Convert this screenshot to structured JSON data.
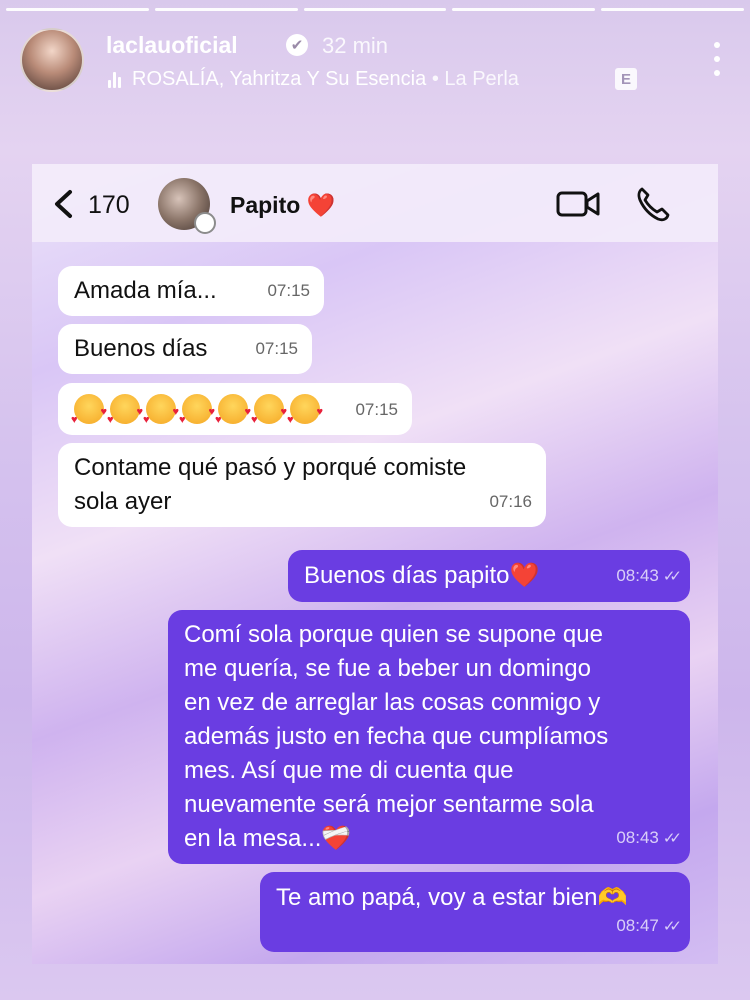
{
  "story": {
    "progress_segments": 5,
    "progress_completed": 5,
    "username": "laclauoficial",
    "verified_glyph": "✔",
    "time_ago": "32 min",
    "music_artists": "ROSALÍA, Yahritza Y Su Esencia",
    "music_separator": "•",
    "music_song": "La Perla",
    "explicit_badge": "E"
  },
  "chat": {
    "back_count": "170",
    "contact_name": "Papito",
    "contact_emoji": "❤️",
    "icons": {
      "back": "chevron-left-icon",
      "video": "video-camera-icon",
      "call": "phone-icon"
    },
    "messages": [
      {
        "direction": "in",
        "text": "Amada mía...",
        "time": "07:15"
      },
      {
        "direction": "in",
        "text": "Buenos días",
        "time": "07:15"
      },
      {
        "direction": "in",
        "text": "🥰🥰🥰🥰🥰🥰🥰",
        "emoji_count": 7,
        "emoji_name": "smiling-face-with-hearts",
        "time": "07:15"
      },
      {
        "direction": "in",
        "text_lines": [
          "Contame qué pasó y porqué comiste",
          "sola ayer"
        ],
        "time": "07:16"
      },
      {
        "direction": "out",
        "text": "Buenos días papito❤️",
        "time": "08:43",
        "ticks": "✓✓"
      },
      {
        "direction": "out",
        "text_lines": [
          "Comí sola porque quien se supone que",
          "me quería, se fue a beber un domingo",
          "en vez de arreglar las cosas conmigo y",
          "además justo en fecha que cumplíamos",
          "mes. Así que me di cuenta que",
          "nuevamente será mejor sentarme sola",
          "en la mesa...❤️‍🩹"
        ],
        "time": "08:43",
        "ticks": "✓✓"
      },
      {
        "direction": "out",
        "text": "Te amo papá, voy a estar bien🫶",
        "time": "08:47",
        "ticks": "✓✓"
      }
    ]
  },
  "colors": {
    "outgoing_bubble": "#6a3de2",
    "incoming_bubble": "#ffffff",
    "heart": "#e0182d"
  }
}
